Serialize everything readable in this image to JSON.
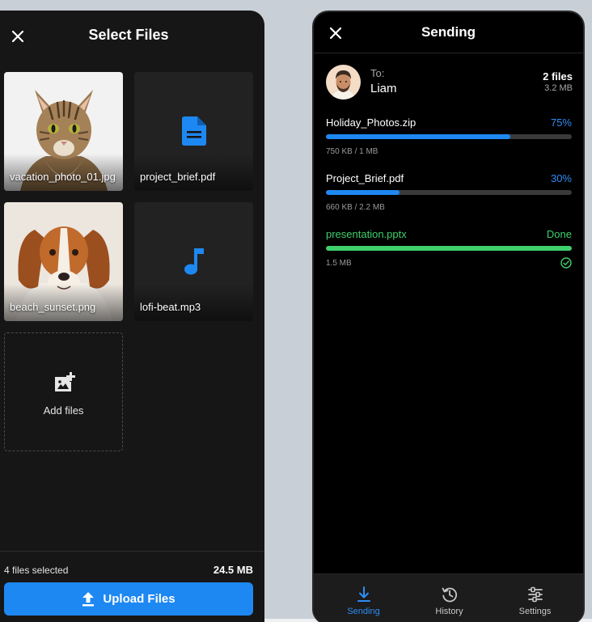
{
  "select_screen": {
    "title": "Select Files",
    "files": [
      {
        "name": "vacation_photo_01.jpg",
        "kind": "image",
        "icon": "cat-photo"
      },
      {
        "name": "project_brief.pdf",
        "kind": "document",
        "icon": "document-icon"
      },
      {
        "name": "beach_sunset.png",
        "kind": "image",
        "icon": "dog-photo"
      },
      {
        "name": "lofi-beat.mp3",
        "kind": "audio",
        "icon": "music-note-icon"
      }
    ],
    "add_label": "Add files",
    "selected_count_text": "4 files selected",
    "total_size": "24.5 MB",
    "upload_label": "Upload Files"
  },
  "sending_screen": {
    "title": "Sending",
    "recipient": {
      "to_label": "To:",
      "name": "Liam"
    },
    "summary": {
      "count": "2 files",
      "size": "3.2 MB"
    },
    "transfers": [
      {
        "name": "Holiday_Photos.zip",
        "status": "75%",
        "progress": 0.75,
        "size": "750 KB / 1 MB",
        "done": false
      },
      {
        "name": "Project_Brief.pdf",
        "status": "30%",
        "progress": 0.3,
        "size": "660 KB / 2.2 MB",
        "done": false
      },
      {
        "name": "presentation.pptx",
        "status": "Done",
        "progress": 1.0,
        "size": "1.5 MB",
        "done": true
      }
    ],
    "tabs": [
      {
        "label": "Sending",
        "icon": "download-arrow-icon",
        "active": true
      },
      {
        "label": "History",
        "icon": "history-icon",
        "active": false
      },
      {
        "label": "Settings",
        "icon": "settings-sliders-icon",
        "active": false
      }
    ]
  },
  "colors": {
    "accent": "#1e88f2",
    "success": "#3fd06b",
    "left_bg": "#161616",
    "right_bg": "#000000"
  }
}
